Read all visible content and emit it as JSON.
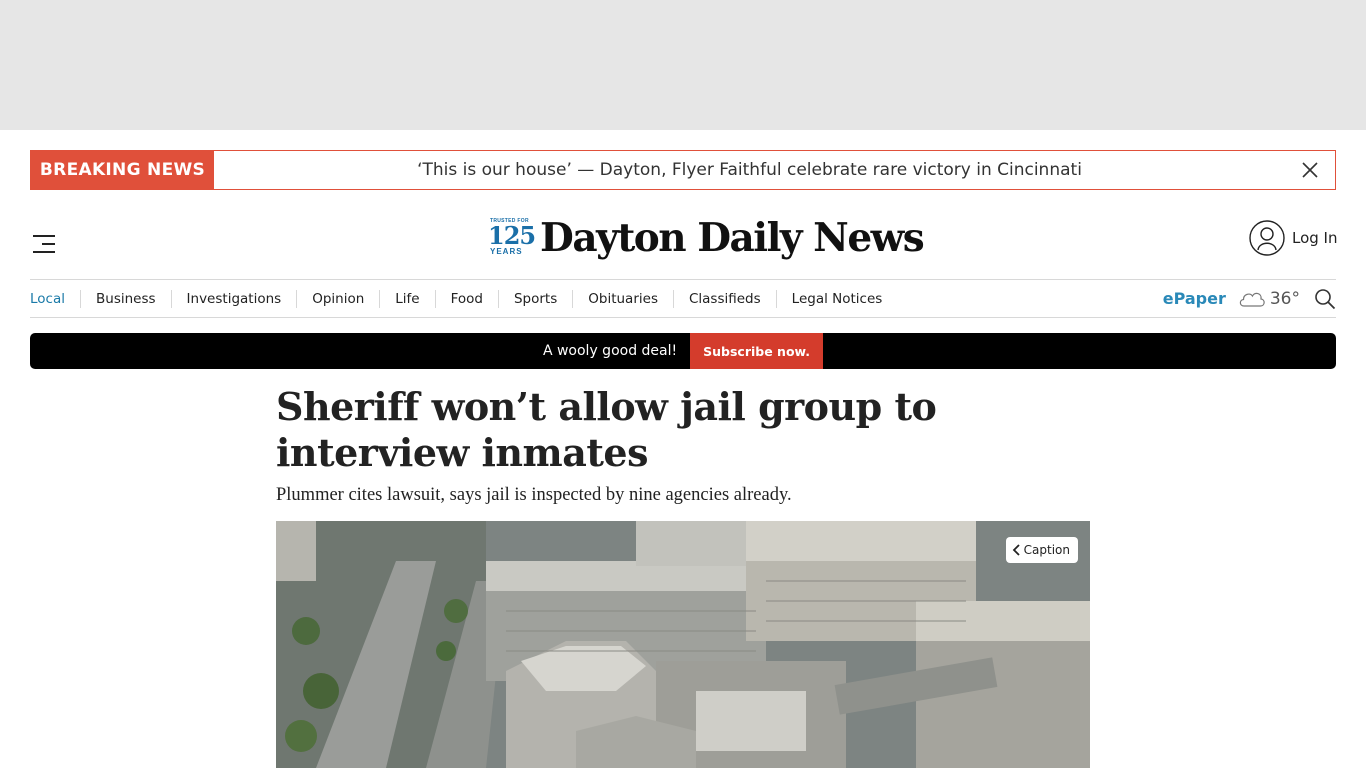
{
  "breaking": {
    "label": "BREAKING NEWS",
    "text": "‘This is our house’ — Dayton, Flyer Faithful celebrate rare victory in Cincinnati",
    "accent": "#e0503a"
  },
  "header": {
    "logo_badge_small": "TRUSTED FOR",
    "logo_badge_number": "125",
    "logo_badge_years": "YEARS",
    "logo_name": "Dayton Daily News",
    "login_label": "Log In"
  },
  "nav": {
    "items": [
      {
        "label": "Local"
      },
      {
        "label": "Business"
      },
      {
        "label": "Investigations"
      },
      {
        "label": "Opinion"
      },
      {
        "label": "Life"
      },
      {
        "label": "Food"
      },
      {
        "label": "Sports"
      },
      {
        "label": "Obituaries"
      },
      {
        "label": "Classifieds"
      },
      {
        "label": "Legal Notices"
      }
    ],
    "epaper_label": "ePaper",
    "temperature": "36°",
    "weather_icon": "cloud-icon",
    "search_icon": "search-icon",
    "active_color": "#1a7aa8"
  },
  "promo": {
    "text": "A wooly good deal!",
    "button_label": "Subscribe now.",
    "button_color": "#d43c2c"
  },
  "article": {
    "headline": "Sheriff won’t allow jail group to interview inmates",
    "subhead": "Plummer cites lawsuit, says jail is inspected by nine agencies already.",
    "caption_label": "Caption"
  }
}
